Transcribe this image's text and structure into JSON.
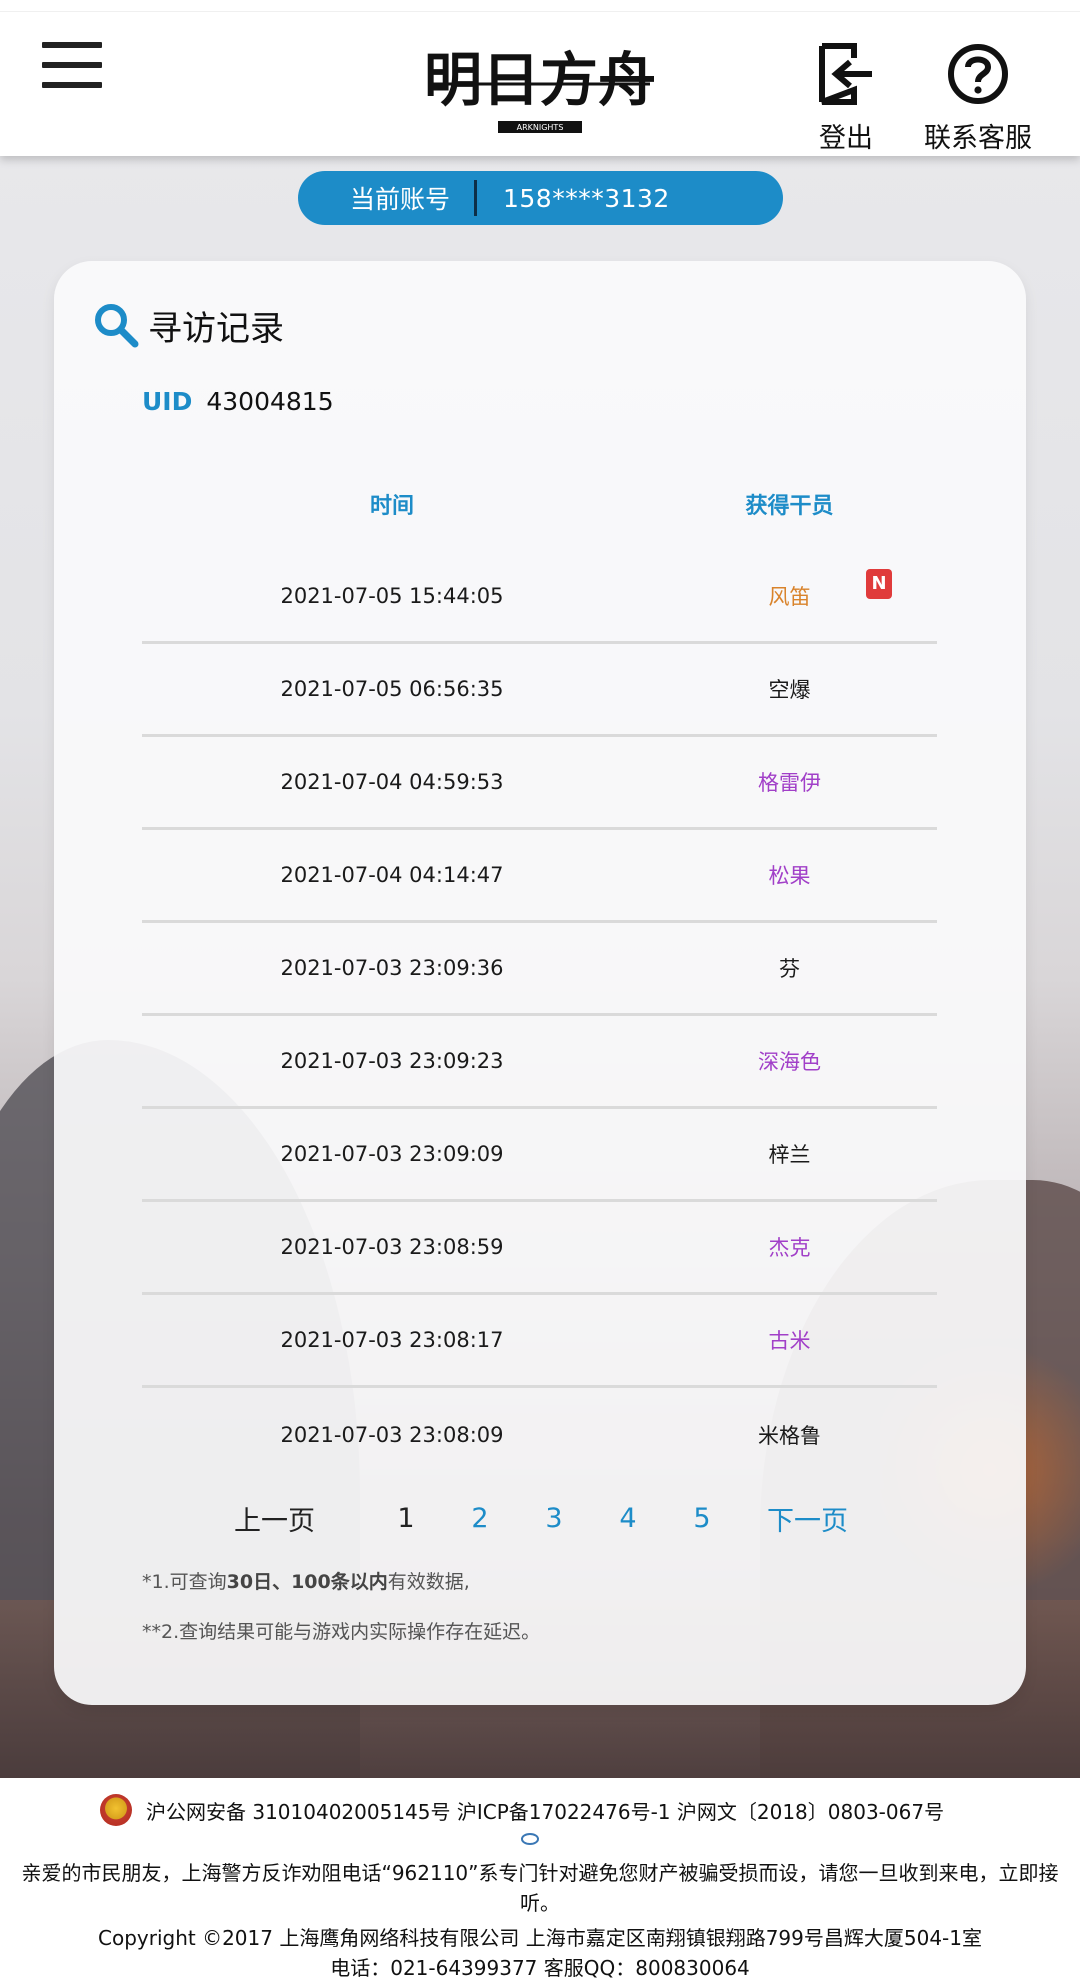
{
  "header": {
    "logo_text": "明日方舟",
    "logo_sub": "ARKNIGHTS",
    "logout_label": "登出",
    "support_label": "联系客服"
  },
  "account": {
    "label": "当前账号",
    "value": "158****3132"
  },
  "card": {
    "title": "寻访记录",
    "uid_label": "UID",
    "uid_value": "43004815",
    "columns": [
      "时间",
      "获得干员"
    ],
    "rows": [
      {
        "time": "2021-07-05 15:44:05",
        "operator": "风笛",
        "rarity_color": "orange",
        "new": "N"
      },
      {
        "time": "2021-07-05 06:56:35",
        "operator": "空爆",
        "rarity_color": "black"
      },
      {
        "time": "2021-07-04 04:59:53",
        "operator": "格雷伊",
        "rarity_color": "purple"
      },
      {
        "time": "2021-07-04 04:14:47",
        "operator": "松果",
        "rarity_color": "purple"
      },
      {
        "time": "2021-07-03 23:09:36",
        "operator": "芬",
        "rarity_color": "black"
      },
      {
        "time": "2021-07-03 23:09:23",
        "operator": "深海色",
        "rarity_color": "purple"
      },
      {
        "time": "2021-07-03 23:09:09",
        "operator": "梓兰",
        "rarity_color": "black"
      },
      {
        "time": "2021-07-03 23:08:59",
        "operator": "杰克",
        "rarity_color": "purple"
      },
      {
        "time": "2021-07-03 23:08:17",
        "operator": "古米",
        "rarity_color": "purple"
      },
      {
        "time": "2021-07-03 23:08:09",
        "operator": "米格鲁",
        "rarity_color": "black"
      }
    ],
    "pager": {
      "prev": "上一页",
      "pages": [
        "1",
        "2",
        "3",
        "4",
        "5"
      ],
      "current": "1",
      "next": "下一页"
    },
    "note1_prefix": "*1.可查询",
    "note1_bold": "30日、100条以内",
    "note1_suffix": "有效数据,",
    "note2": "**2.查询结果可能与游戏内实际操作存在延迟。"
  },
  "footer": {
    "line1": "沪公网安备 31010402005145号  沪ICP备17022476号-1  沪网文〔2018〕0803-067号",
    "line2": "亲爱的市民朋友，上海警方反诈劝阻电话“962110”系专门针对避免您财产被骗受损而设，请您一旦收到来电，立即接听。",
    "line3": "Copyright ©2017 上海鹰角网络科技有限公司  上海市嘉定区南翔镇银翔路799号昌辉大厦504-1室",
    "line4": "电话：021-64399377 客服QQ：800830064"
  },
  "colors": {
    "accent": "#1d8cc8",
    "orange": "#d9832b",
    "purple": "#a13fc8",
    "badge": "#e03b3b"
  }
}
